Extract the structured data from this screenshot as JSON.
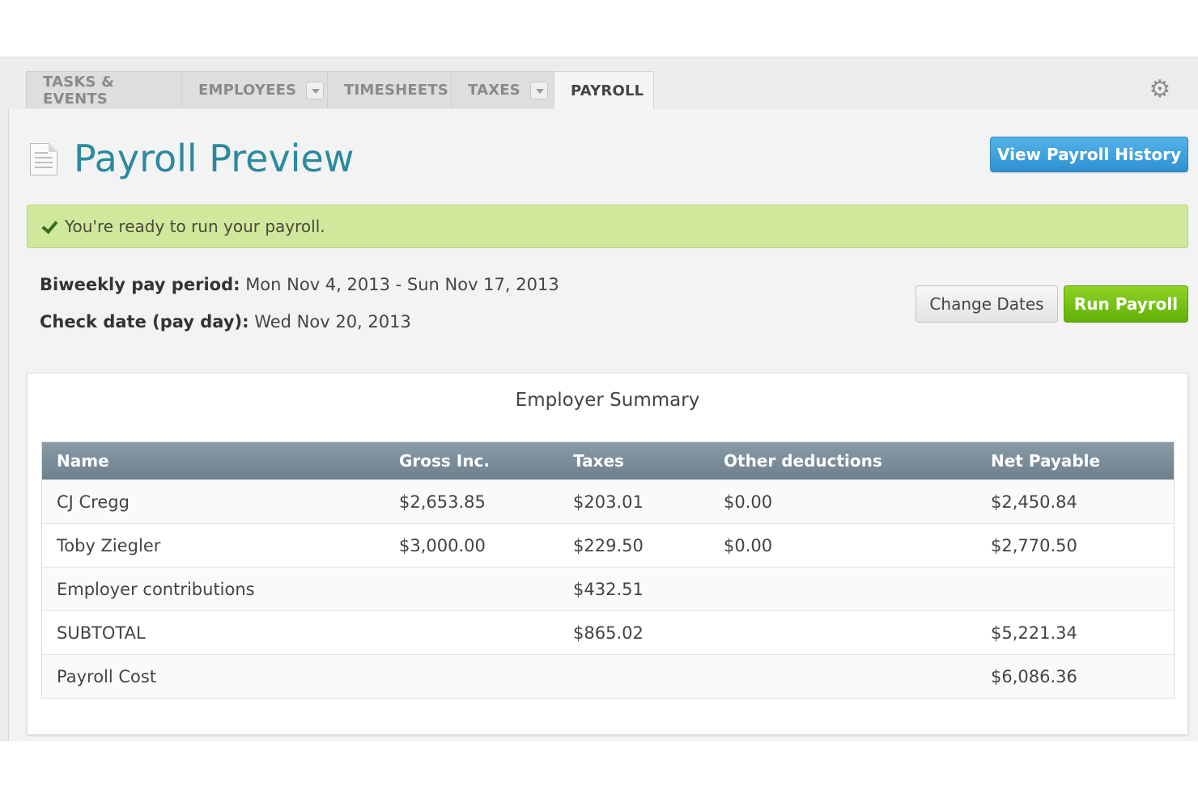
{
  "tabs": [
    {
      "label": "TASKS & EVENTS",
      "dropdown": false,
      "active": false
    },
    {
      "label": "EMPLOYEES",
      "dropdown": true,
      "active": false
    },
    {
      "label": "TIMESHEETS",
      "dropdown": false,
      "active": false
    },
    {
      "label": "TAXES",
      "dropdown": true,
      "active": false
    },
    {
      "label": "PAYROLL",
      "dropdown": false,
      "active": true
    }
  ],
  "header": {
    "title": "Payroll Preview",
    "history_button": "View Payroll History"
  },
  "alert": {
    "text": "You're ready to run your payroll."
  },
  "period": {
    "pay_period_label": "Biweekly pay period:",
    "pay_period_value": "Mon Nov 4, 2013 - Sun Nov 17, 2013",
    "check_date_label": "Check date (pay day):",
    "check_date_value": "Wed Nov 20, 2013"
  },
  "actions": {
    "change_dates": "Change Dates",
    "run_payroll": "Run Payroll"
  },
  "summary": {
    "title": "Employer Summary",
    "columns": [
      "Name",
      "Gross Inc.",
      "Taxes",
      "Other deductions",
      "Net Payable"
    ],
    "rows": [
      [
        "CJ Cregg",
        "$2,653.85",
        "$203.01",
        "$0.00",
        "$2,450.84"
      ],
      [
        "Toby Ziegler",
        "$3,000.00",
        "$229.50",
        "$0.00",
        "$2,770.50"
      ],
      [
        "Employer contributions",
        "",
        "$432.51",
        "",
        ""
      ],
      [
        "SUBTOTAL",
        "",
        "$865.02",
        "",
        "$5,221.34"
      ],
      [
        "Payroll Cost",
        "",
        "",
        "",
        "$6,086.36"
      ]
    ]
  },
  "icons": {
    "settings": "gear-icon",
    "page": "document-icon",
    "success": "checkmark-icon"
  },
  "colors": {
    "title": "#2b8a9e",
    "primary_button": "#3a9ad8",
    "run_button": "#76c11a",
    "alert_bg": "#d0e89c"
  }
}
